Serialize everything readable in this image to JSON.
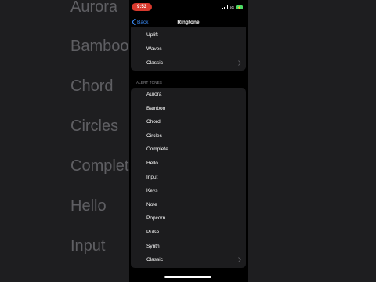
{
  "status_bar": {
    "time": "9:53",
    "network": "5G"
  },
  "nav": {
    "back_label": "Back",
    "title": "Ringtone"
  },
  "ringtone_tail": [
    "Uplift",
    "Waves",
    "Classic"
  ],
  "alert_tones_header": "ALERT TONES",
  "alert_tones": [
    "Aurora",
    "Bamboo",
    "Chord",
    "Circles",
    "Complete",
    "Hello",
    "Input",
    "Keys",
    "Note",
    "Popcorn",
    "Pulse",
    "Synth",
    "Classic"
  ],
  "background_words": [
    "Aurora",
    "Bamboo",
    "Chord",
    "Circles",
    "Complete",
    "Hello",
    "Input"
  ],
  "colors": {
    "accent": "#3b8cf7",
    "time_pill": "#d9392d",
    "battery": "#4cd964"
  }
}
